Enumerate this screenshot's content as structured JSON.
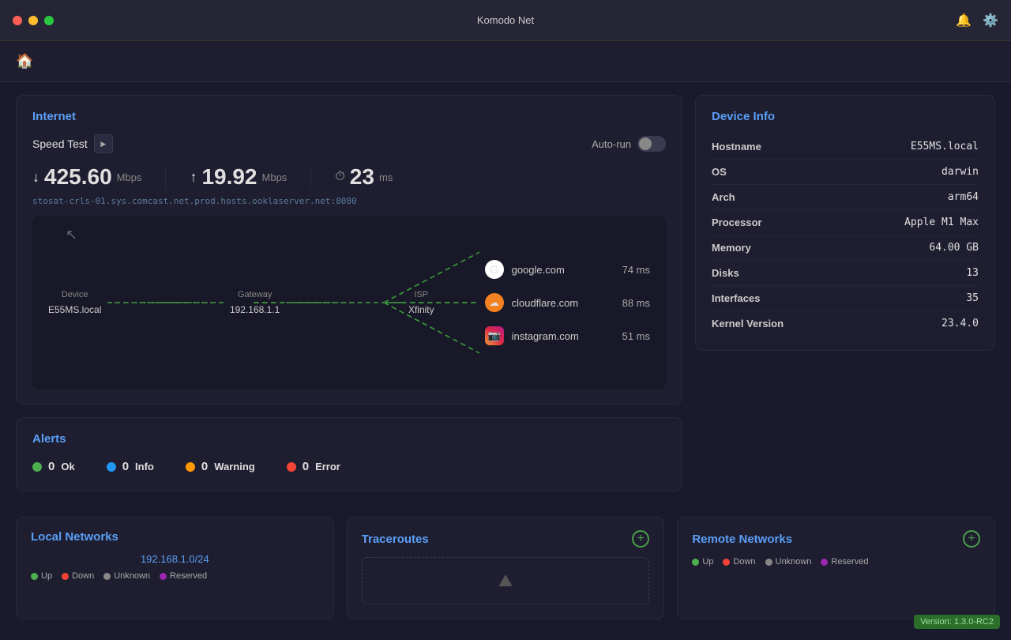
{
  "app": {
    "title": "Komodo Net"
  },
  "titlebar": {
    "tl_red": "close",
    "tl_yellow": "minimize",
    "tl_green": "maximize"
  },
  "toolbar": {
    "home_label": "home"
  },
  "internet": {
    "title": "Internet",
    "speed_test_label": "Speed Test",
    "auto_run_label": "Auto-run",
    "download_value": "425.60",
    "download_unit": "Mbps",
    "upload_value": "19.92",
    "upload_unit": "Mbps",
    "ping_value": "23",
    "ping_unit": "ms",
    "server_url": "stosat-crls-01.sys.comcast.net.prod.hosts.ooklaserver.net:8080"
  },
  "network_map": {
    "device_label": "Device",
    "device_value": "E55MS.local",
    "gateway_label": "Gateway",
    "gateway_value": "192.168.1.1",
    "isp_label": "ISP",
    "isp_value": "Xfinity",
    "destinations": [
      {
        "name": "google.com",
        "ms": "74 ms",
        "icon": "google"
      },
      {
        "name": "cloudflare.com",
        "ms": "88 ms",
        "icon": "cloudflare"
      },
      {
        "name": "instagram.com",
        "ms": "51 ms",
        "icon": "instagram"
      }
    ]
  },
  "alerts": {
    "title": "Alerts",
    "items": [
      {
        "label": "Ok",
        "count": "0",
        "color": "#4caf50"
      },
      {
        "label": "Info",
        "count": "0",
        "color": "#2196f3"
      },
      {
        "label": "Warning",
        "count": "0",
        "color": "#ff9800"
      },
      {
        "label": "Error",
        "count": "0",
        "color": "#f44336"
      }
    ]
  },
  "device_info": {
    "title": "Device Info",
    "rows": [
      {
        "key": "Hostname",
        "value": "E55MS.local"
      },
      {
        "key": "OS",
        "value": "darwin"
      },
      {
        "key": "Arch",
        "value": "arm64"
      },
      {
        "key": "Processor",
        "value": "Apple M1 Max"
      },
      {
        "key": "Memory",
        "value": "64.00 GB"
      },
      {
        "key": "Disks",
        "value": "13"
      },
      {
        "key": "Interfaces",
        "value": "35"
      },
      {
        "key": "Kernel Version",
        "value": "23.4.0"
      }
    ]
  },
  "local_networks": {
    "title": "Local Networks",
    "ip": "192.168.1.0/24",
    "legend": [
      {
        "label": "Up",
        "color": "#4caf50"
      },
      {
        "label": "Down",
        "color": "#f44336"
      },
      {
        "label": "Unknown",
        "color": "#888"
      },
      {
        "label": "Reserved",
        "color": "#9c27b0"
      }
    ]
  },
  "traceroutes": {
    "title": "Traceroutes",
    "placeholder_icon": "⛰"
  },
  "remote_networks": {
    "title": "Remote Networks",
    "legend": [
      {
        "label": "Up",
        "color": "#4caf50"
      },
      {
        "label": "Down",
        "color": "#f44336"
      },
      {
        "label": "Unknown",
        "color": "#888"
      },
      {
        "label": "Reserved",
        "color": "#9c27b0"
      }
    ]
  },
  "version": {
    "label": "Version: 1.3.0-RC2"
  },
  "status": {
    "unknown1": "Unknown",
    "unknown2": "Unknown"
  }
}
